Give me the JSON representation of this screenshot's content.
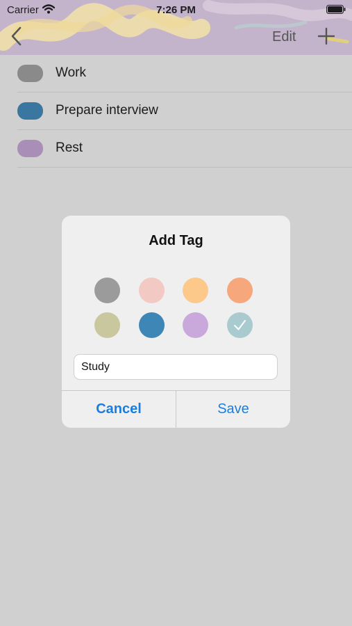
{
  "status_bar": {
    "carrier": "Carrier",
    "time": "7:26 PM"
  },
  "nav_bar": {
    "edit_label": "Edit",
    "back_icon": "chevron-left-icon",
    "add_icon": "plus-icon"
  },
  "tags": [
    {
      "label": "Work",
      "color": "#8a8a8a"
    },
    {
      "label": "Prepare interview",
      "color": "#3a77a0"
    },
    {
      "label": "Rest",
      "color": "#a98fb8"
    }
  ],
  "dialog": {
    "title": "Add Tag",
    "colors": [
      {
        "color": "#9b9b9b",
        "selected": false
      },
      {
        "color": "#f2c9c3",
        "selected": false
      },
      {
        "color": "#fcc98a",
        "selected": false
      },
      {
        "color": "#f7a77c",
        "selected": false
      },
      {
        "color": "#c9c79e",
        "selected": false
      },
      {
        "color": "#3e86b5",
        "selected": false
      },
      {
        "color": "#c9a9dc",
        "selected": false
      },
      {
        "color": "#a9cbd0",
        "selected": true
      }
    ],
    "name_value": "Study",
    "cancel_label": "Cancel",
    "save_label": "Save"
  }
}
